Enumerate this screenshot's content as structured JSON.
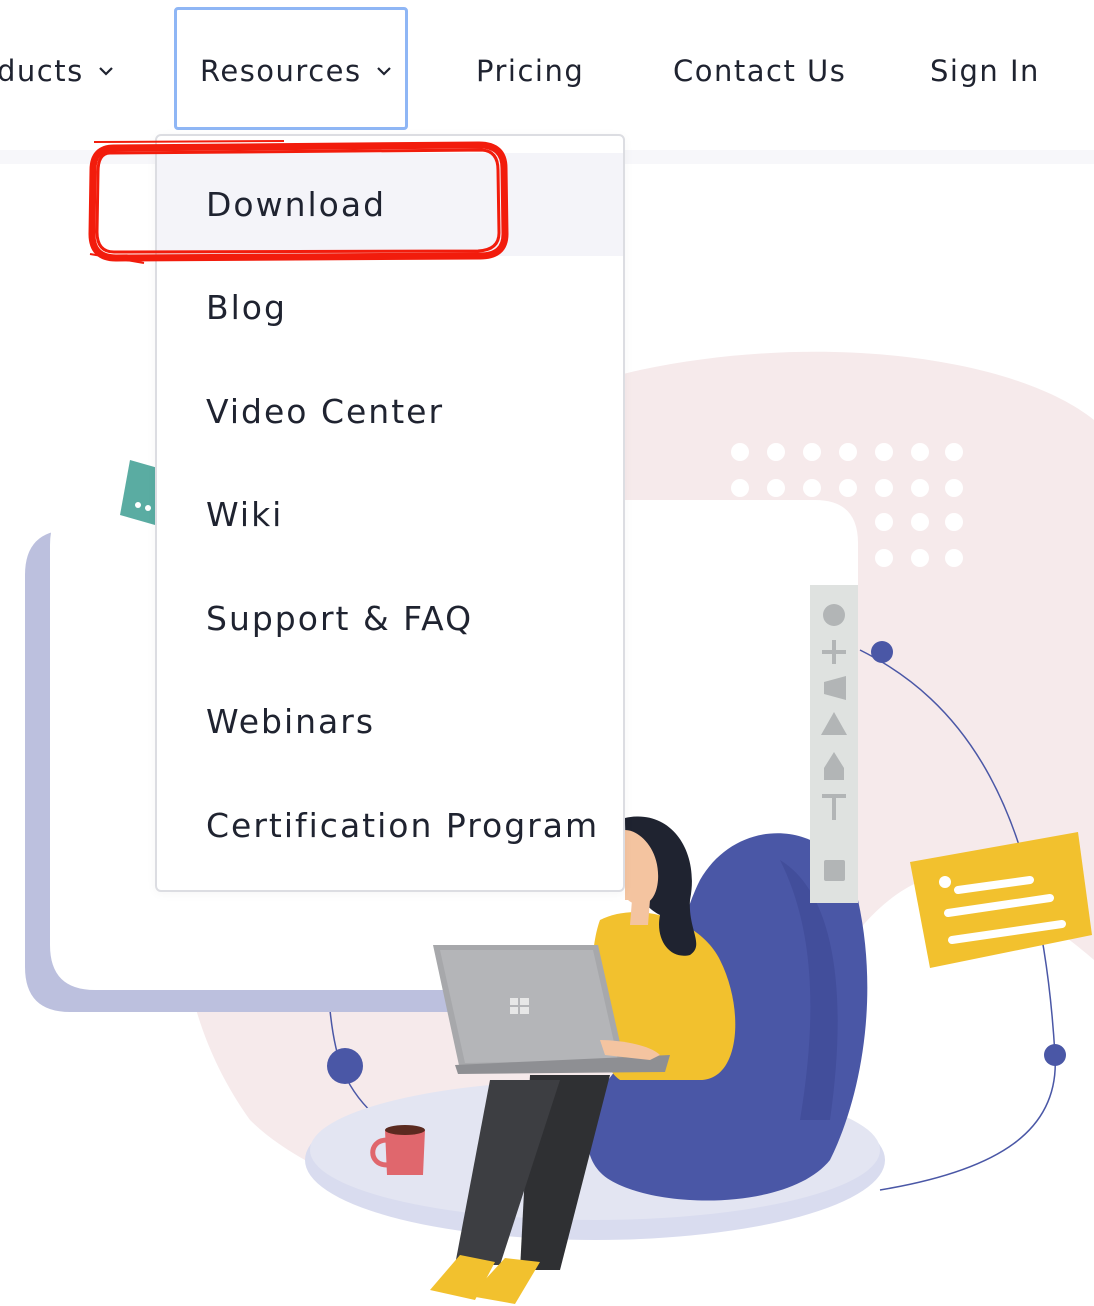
{
  "nav": {
    "items": [
      {
        "label": "ducts",
        "has_chevron": true
      },
      {
        "label": "Resources",
        "has_chevron": true,
        "focused": true
      },
      {
        "label": "Pricing",
        "has_chevron": false
      },
      {
        "label": "Contact Us",
        "has_chevron": false
      },
      {
        "label": "Sign In",
        "has_chevron": false
      }
    ]
  },
  "dropdown": {
    "items": [
      {
        "label": "Download",
        "highlighted": true
      },
      {
        "label": "Blog"
      },
      {
        "label": "Video Center"
      },
      {
        "label": "Wiki"
      },
      {
        "label": "Support & FAQ"
      },
      {
        "label": "Webinars"
      },
      {
        "label": "Certification Program"
      }
    ]
  },
  "colors": {
    "text": "#1f2330",
    "focus_ring": "#8fb6f5",
    "annotation_red": "#f21c0c",
    "accent_indigo": "#4a57a6",
    "accent_yellow": "#f2c12e",
    "blob_pink": "#f6eaeb",
    "frame_lavender": "#bcc0de",
    "toolbar_gray": "#dfe2e0"
  },
  "icons": {
    "nav_chevron": "chevron-down-icon",
    "toolbar": [
      "circle-tool-icon",
      "plus-tool-icon",
      "flag-tool-icon",
      "triangle-tool-icon",
      "pen-tool-icon",
      "text-tool-icon",
      "square-tool-icon"
    ],
    "laptop_logo": "windows-logo-icon"
  }
}
